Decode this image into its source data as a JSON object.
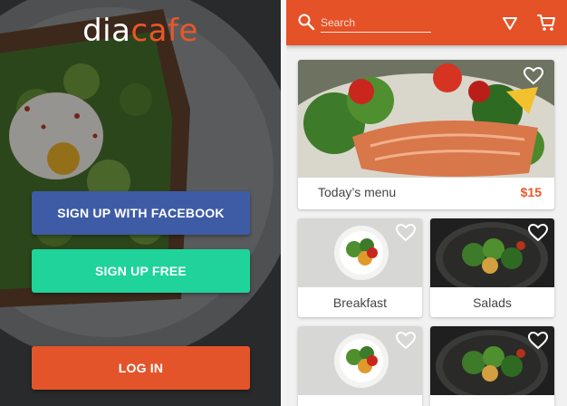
{
  "brand": {
    "part1": "dia",
    "part2": "cafe"
  },
  "signup": {
    "facebook_label": "SIGN UP WITH FACEBOOK",
    "free_label": "SIGN UP FREE",
    "login_label": "LOG IN"
  },
  "search": {
    "placeholder": "Search",
    "value": ""
  },
  "icons": [
    "search-icon",
    "filter-icon",
    "cart-icon",
    "heart-icon"
  ],
  "featured": {
    "title": "Today’s  menu",
    "price": "$15"
  },
  "categories": [
    {
      "label": "Breakfast"
    },
    {
      "label": "Salads"
    },
    {
      "label": ""
    },
    {
      "label": ""
    }
  ],
  "colors": {
    "brand_orange": "#e8572a",
    "facebook_blue": "#3e5ba6",
    "signup_green": "#1fd39b",
    "login_orange": "#e4542a",
    "appbar_orange": "#e55227",
    "price_orange": "#e8572a"
  }
}
